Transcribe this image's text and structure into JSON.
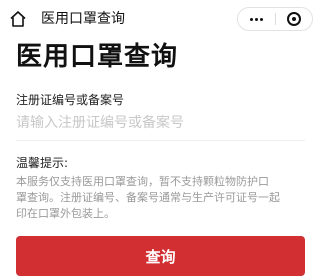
{
  "navbar": {
    "title": "医用口罩查询",
    "home_icon": "home-icon",
    "more_icon": "more-dots-icon",
    "close_icon": "target-close-icon"
  },
  "page": {
    "heading": "医用口罩查询"
  },
  "form": {
    "label": "注册证编号或备案号",
    "value": "",
    "placeholder": "请输入注册证编号或备案号"
  },
  "tips": {
    "title": "温馨提示:",
    "lines": [
      "本服务仅支持医用口罩查询，暂不支持颗粒物防护口",
      "罩查询。注册证编号、备案号通常与生产许可证号一起",
      "印在口罩外包装上。"
    ]
  },
  "actions": {
    "search_label": "查询",
    "button_color": "#d12f32"
  }
}
